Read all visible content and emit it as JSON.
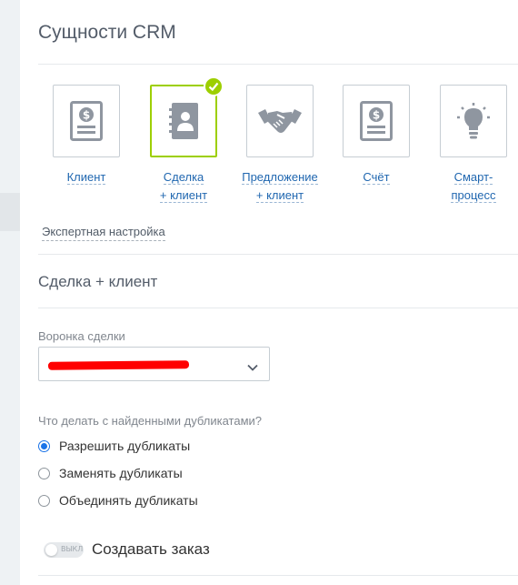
{
  "title": "Сущности CRM",
  "entities": [
    {
      "line1": "Клиент",
      "line2": "",
      "icon": "document-dollar-icon",
      "selected": false
    },
    {
      "line1": "Сделка",
      "line2": "+ клиент",
      "icon": "contact-book-icon",
      "selected": true
    },
    {
      "line1": "Предложение",
      "line2": "+ клиент",
      "icon": "handshake-icon",
      "selected": false
    },
    {
      "line1": "Счёт",
      "line2": "",
      "icon": "document-dollar-icon",
      "selected": false
    },
    {
      "line1": "Смарт-",
      "line2": "процесс",
      "icon": "lightbulb-icon",
      "selected": false
    }
  ],
  "expert_link": "Экспертная настройка",
  "section_title": "Сделка + клиент",
  "pipeline": {
    "label": "Воронка сделки",
    "value": ""
  },
  "duplicates": {
    "question": "Что делать с найденными дубликатами?",
    "options": [
      {
        "label": "Разрешить дубликаты",
        "checked": true
      },
      {
        "label": "Заменять дубликаты",
        "checked": false
      },
      {
        "label": "Объединять дубликаты",
        "checked": false
      }
    ]
  },
  "create_order": {
    "toggle_state": "ВЫКЛ",
    "label": "Создавать заказ",
    "enabled": false
  },
  "colors": {
    "accent_green": "#9dcf00",
    "link_blue": "#2067b0",
    "radio_blue": "#1a73e8",
    "icon_gray": "#8f96a0"
  }
}
